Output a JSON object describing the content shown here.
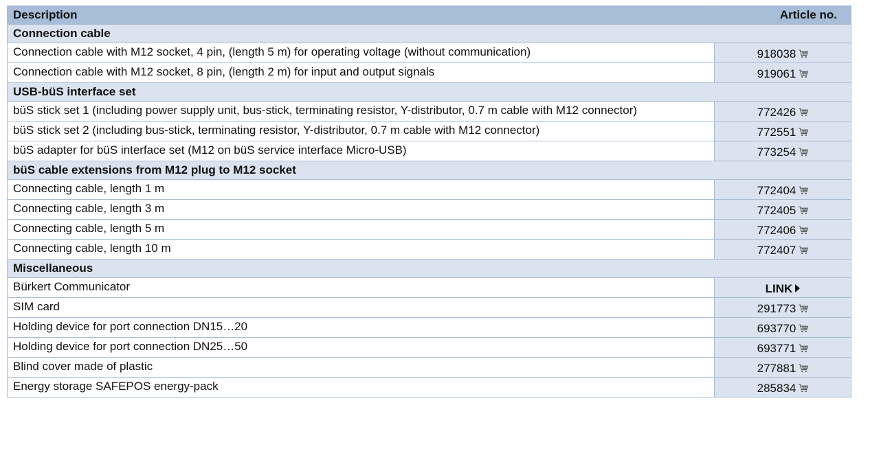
{
  "header": {
    "description": "Description",
    "article_no": "Article no."
  },
  "sections": [
    {
      "title": "Connection cable",
      "items": [
        {
          "description": "Connection cable with M12 socket, 4 pin, (length 5 m) for operating voltage (without communication)",
          "article": "918038"
        },
        {
          "description": "Connection cable with M12 socket, 8 pin, (length 2 m) for input and output signals",
          "article": "919061"
        }
      ]
    },
    {
      "title": "USB-büS interface set",
      "items": [
        {
          "description": "büS stick set 1 (including power supply unit, bus-stick, terminating resistor, Y-distributor, 0.7 m cable with M12 connector)",
          "article": "772426"
        },
        {
          "description": "büS stick set 2 (including bus-stick, terminating resistor, Y-distributor, 0.7 m cable with M12 connector)",
          "article": "772551"
        },
        {
          "description": "büS adapter for büS interface set (M12 on büS service interface Micro-USB)",
          "article": "773254"
        }
      ]
    },
    {
      "title": "büS cable extensions from M12 plug to M12 socket",
      "items": [
        {
          "description": "Connecting cable, length 1 m",
          "article": "772404"
        },
        {
          "description": "Connecting cable, length 3 m",
          "article": "772405"
        },
        {
          "description": "Connecting cable, length 5 m",
          "article": "772406"
        },
        {
          "description": "Connecting cable, length 10 m",
          "article": "772407"
        }
      ]
    },
    {
      "title": "Miscellaneous",
      "items": [
        {
          "description": "Bürkert Communicator",
          "link": "LINK"
        },
        {
          "description": "SIM card",
          "article": "291773"
        },
        {
          "description": "Holding device for port connection DN15…20",
          "article": "693770"
        },
        {
          "description": "Holding device for port connection DN25…50",
          "article": "693771"
        },
        {
          "description": "Blind cover made of plastic",
          "article": "277881"
        },
        {
          "description": "Energy storage SAFEPOS energy-pack",
          "article": "285834"
        }
      ]
    }
  ]
}
